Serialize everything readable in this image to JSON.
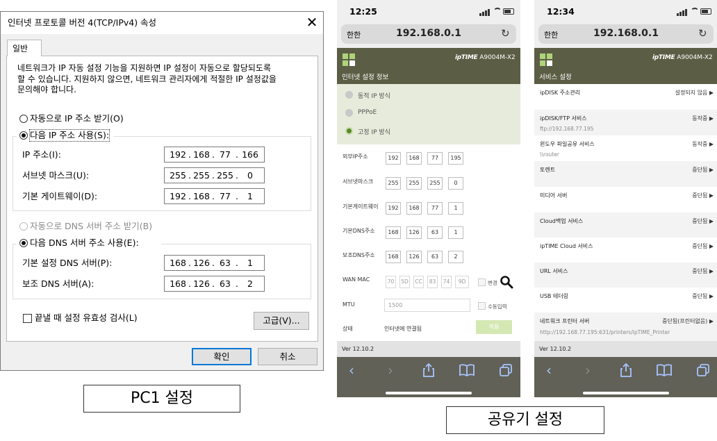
{
  "dialog": {
    "title": "인터넷 프로토콜 버전 4(TCP/IPv4) 속성",
    "tab": "일반",
    "description": "네트워크가 IP 자동 설정 기능을 지원하면 IP 설정이 자동으로 할당되도록\n할 수 있습니다. 지원하지 않으면, 네트워크 관리자에게 적절한 IP 설정값을\n문의해야 합니다.",
    "auto_ip": "자동으로 IP 주소 받기(O)",
    "manual_ip": "다음 IP 주소 사용(S):",
    "ip_label": "IP 주소(I):",
    "ip": [
      "192",
      "168",
      "77",
      "166"
    ],
    "subnet_label": "서브넷 마스크(U):",
    "subnet": [
      "255",
      "255",
      "255",
      "0"
    ],
    "gateway_label": "기본 게이트웨이(D):",
    "gateway": [
      "192",
      "168",
      "77",
      "1"
    ],
    "auto_dns": "자동으로 DNS 서버 주소 받기(B)",
    "manual_dns": "다음 DNS 서버 주소 사용(E):",
    "dns1_label": "기본 설정 DNS 서버(P):",
    "dns1": [
      "168",
      "126",
      "63",
      "1"
    ],
    "dns2_label": "보조 DNS 서버(A):",
    "dns2": [
      "168",
      "126",
      "63",
      "2"
    ],
    "validate": "끝낼 때 설정 유효성 검사(L)",
    "advanced": "고급(V)...",
    "ok": "확인",
    "cancel": "취소"
  },
  "caption_pc": "PC1 설정",
  "caption_router": "공유기 설정",
  "phone1": {
    "time": "12:25",
    "url_left": "한한",
    "url": "192.168.0.1",
    "brand": "ipTIME",
    "model": "A9004M-X2",
    "page_title": "인터넷 설정 정보",
    "options": [
      "동적 IP 방식",
      "PPPoE",
      "고정 IP 방식"
    ],
    "selected": 2,
    "wan_ip_label": "외부IP주소",
    "wan_ip": [
      "192",
      "168",
      "77",
      "195"
    ],
    "mask_label": "서브넷마스크",
    "mask": [
      "255",
      "255",
      "255",
      "0"
    ],
    "gw_label": "기본게이트웨이",
    "gw": [
      "192",
      "168",
      "77",
      "1"
    ],
    "dns1_label": "기본DNS주소",
    "dns1": [
      "168",
      "126",
      "63",
      "1"
    ],
    "dns2_label": "보조DNS주소",
    "dns2": [
      "168",
      "126",
      "63",
      "2"
    ],
    "mac_label": "WAN MAC",
    "mac": [
      "70",
      "5D",
      "CC",
      "83",
      "74",
      "9D"
    ],
    "change": "변경",
    "mtu_label": "MTU",
    "mtu": "1500",
    "manual": "수동입력",
    "status_label": "상태",
    "status": "인터넷에 연결됨",
    "apply": "적용",
    "version": "Ver 12.10.2"
  },
  "phone2": {
    "time": "12:34",
    "url_left": "한한",
    "url": "192.168.0.1",
    "brand": "ipTIME",
    "model": "A9004M-X2",
    "page_title": "서비스 설정",
    "services": [
      {
        "name": "ipDISK 주소관리",
        "status": "설정되지 않음 ▶",
        "sub": ""
      },
      {
        "name": "ipDISK/FTP 서비스",
        "status": "동작중 ▶",
        "sub": "ftp://192.168.77.195"
      },
      {
        "name": "윈도우 파일공유 서비스",
        "status": "동작중 ▶",
        "sub": "\\\\router"
      },
      {
        "name": "토렌트",
        "status": "중단됨 ▶",
        "sub": ""
      },
      {
        "name": "미디어 서버",
        "status": "중단됨 ▶",
        "sub": ""
      },
      {
        "name": "Cloud백업 서비스",
        "status": "중단됨 ▶",
        "sub": ""
      },
      {
        "name": "ipTIME Cloud 서비스",
        "status": "중단됨 ▶",
        "sub": ""
      },
      {
        "name": "URL 서비스",
        "status": "중단됨 ▶",
        "sub": ""
      },
      {
        "name": "USB 테더링",
        "status": "중단됨 ▶",
        "sub": ""
      },
      {
        "name": "네트워크 프린터 서버",
        "status": "중단됨(프린터없음) ▶",
        "sub": "http://192.168.77.195:631/printers/ipTIME_Printer"
      }
    ],
    "version": "Ver 12.10.2"
  }
}
